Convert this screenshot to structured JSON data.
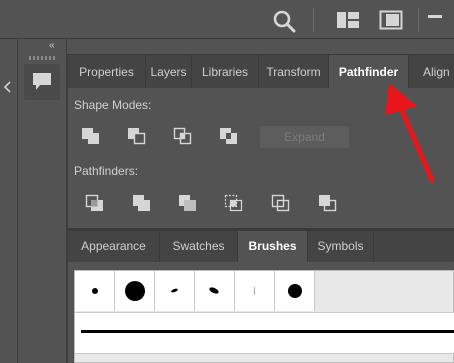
{
  "top_bar": {
    "icons": [
      "search-icon",
      "workspace-layout-icon",
      "panel-display-icon",
      "minimize-icon"
    ]
  },
  "dock": {
    "collapse_glyph": "‹‹",
    "left_glyph": "‹",
    "comment_icon": "comment-icon"
  },
  "pathfinder_panel": {
    "tabs": [
      "Properties",
      "Layers",
      "Libraries",
      "Transform",
      "Pathfinder",
      "Align"
    ],
    "active_tab": "Pathfinder",
    "shape_modes_label": "Shape Modes:",
    "shape_mode_tools": [
      "unite-icon",
      "minus-front-icon",
      "intersect-icon",
      "exclude-icon"
    ],
    "expand_label": "Expand",
    "pathfinders_label": "Pathfinders:",
    "pathfinder_tools": [
      "divide-icon",
      "trim-icon",
      "merge-icon",
      "crop-icon",
      "outline-icon",
      "minus-back-icon"
    ]
  },
  "brushes_panel": {
    "tabs": [
      "Appearance",
      "Swatches",
      "Brushes",
      "Symbols"
    ],
    "active_tab": "Brushes",
    "brush_presets": [
      "round-dot-small",
      "round-dot-large",
      "calligraphic-small",
      "calligraphic-medium",
      "hairline",
      "round-dot-medium"
    ]
  },
  "colors": {
    "panel_bg": "#535353",
    "tab_bg": "#444444",
    "annotation_arrow": "#e8161b"
  }
}
